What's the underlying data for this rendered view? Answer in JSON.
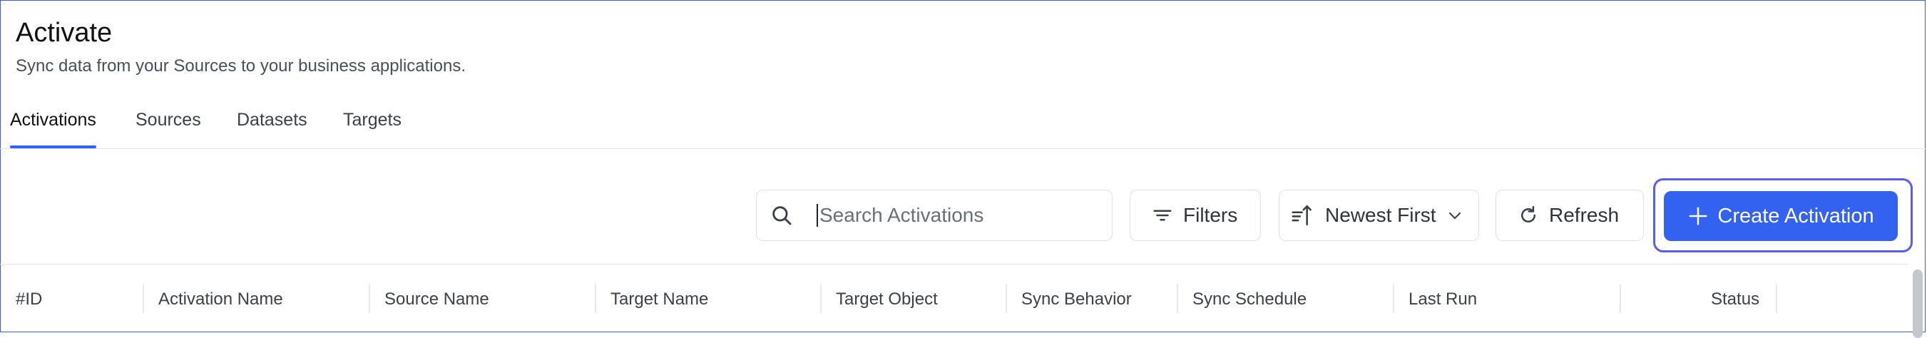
{
  "header": {
    "title": "Activate",
    "subtitle": "Sync data from your Sources to your business applications."
  },
  "tabs": [
    {
      "label": "Activations",
      "active": true
    },
    {
      "label": "Sources",
      "active": false
    },
    {
      "label": "Datasets",
      "active": false
    },
    {
      "label": "Targets",
      "active": false
    }
  ],
  "toolbar": {
    "search": {
      "placeholder": "Search Activations",
      "value": "",
      "icon": "search-icon"
    },
    "filters_label": "Filters",
    "sort_label": "Newest First",
    "refresh_label": "Refresh",
    "create_label": "Create Activation"
  },
  "table": {
    "columns": [
      "#ID",
      "Activation Name",
      "Source Name",
      "Target Name",
      "Target Object",
      "Sync Behavior",
      "Sync Schedule",
      "Last Run",
      "Status"
    ]
  },
  "colors": {
    "accent": "#3462f0",
    "focus_ring": "#5b5cf0",
    "window_border": "#3f5bd8"
  }
}
